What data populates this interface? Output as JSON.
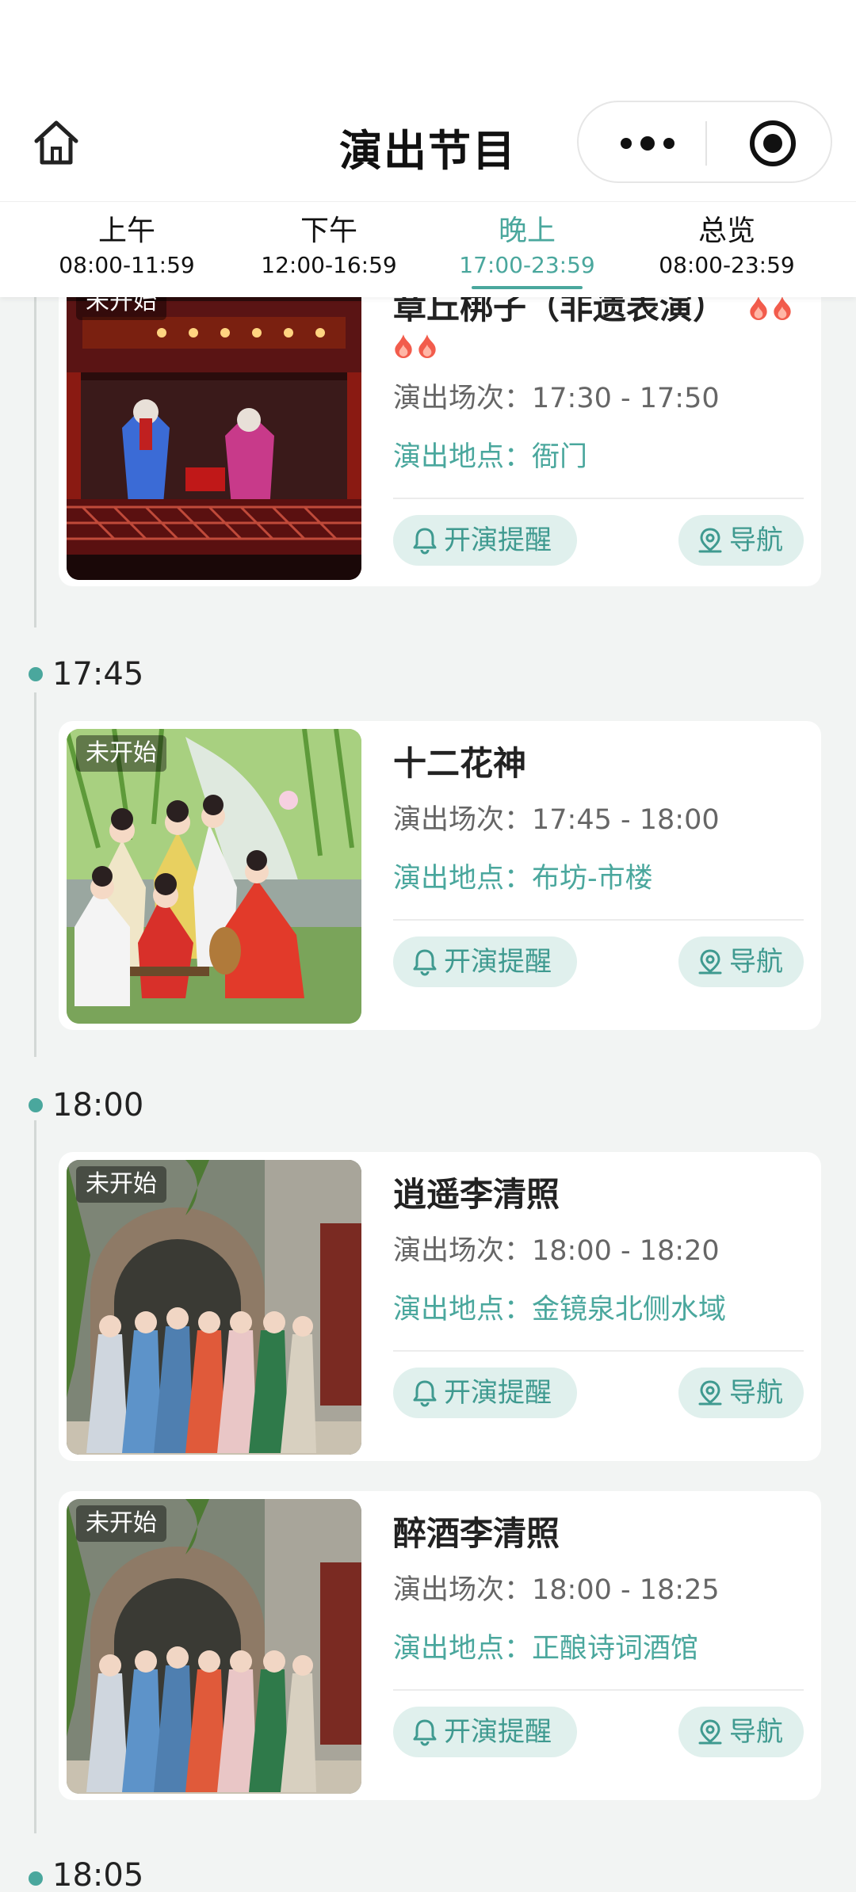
{
  "header": {
    "title": "演出节目"
  },
  "tabs": [
    {
      "name": "上午",
      "time": "08:00-11:59",
      "active": false
    },
    {
      "name": "下午",
      "time": "12:00-16:59",
      "active": false
    },
    {
      "name": "晚上",
      "time": "17:00-23:59",
      "active": true
    },
    {
      "name": "总览",
      "time": "08:00-23:59",
      "active": false
    }
  ],
  "labels": {
    "session_prefix": "演出场次：",
    "location_prefix": "演出地点：",
    "remind_button": "开演提醒",
    "nav_button": "导航"
  },
  "timeline": [
    {
      "time": "",
      "shows": [
        {
          "status": "未开始",
          "title": "章丘梆子（非遗表演）",
          "hot_level": 4,
          "session": "17:30 - 17:50",
          "location": "衙门",
          "image": "opera-stage-photo"
        }
      ]
    },
    {
      "time": "17:45",
      "shows": [
        {
          "status": "未开始",
          "title": "十二花神",
          "session": "17:45 - 18:00",
          "location": "布坊-市楼",
          "image": "flower-goddess-photo"
        }
      ]
    },
    {
      "time": "18:00",
      "shows": [
        {
          "status": "未开始",
          "title": "逍遥李清照",
          "session": "18:00 - 18:20",
          "location": "金镜泉北侧水域",
          "image": "archway-performers-photo"
        },
        {
          "status": "未开始",
          "title": "醉酒李清照",
          "session": "18:00 - 18:25",
          "location": "正酿诗词酒馆",
          "image": "archway-performers-photo"
        }
      ]
    },
    {
      "time": "18:05",
      "shows": []
    }
  ],
  "colors": {
    "accent": "#4aa79d",
    "pill_bg": "#e0f0ed",
    "hot": "#f25c4c"
  }
}
